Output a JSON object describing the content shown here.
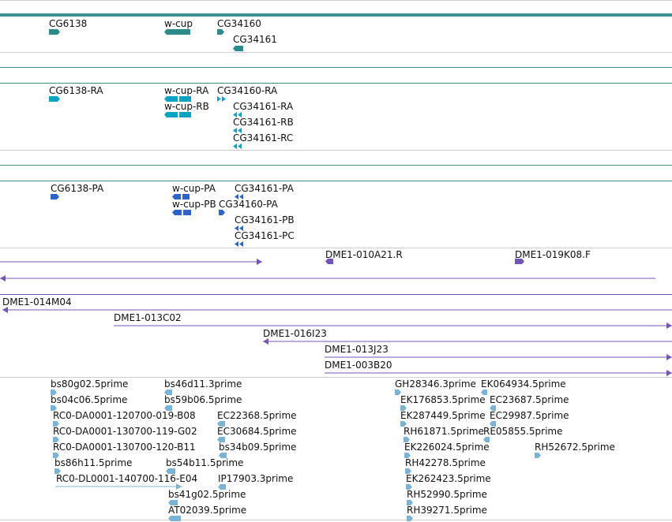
{
  "colors": {
    "gene": "#2b8a8a",
    "mrna": "#0aa3c2",
    "protein": "#2d63c9",
    "clone": "#7355b5",
    "est": "#7ab3d6",
    "divider_gray": "#cfcfcf",
    "divider_teal": "#3f8f8f",
    "divider_purple": "#6b52a8",
    "top_bar": "#3d9090"
  },
  "tracks": {
    "genes": [
      {
        "label": "CG6138",
        "dir": "right"
      },
      {
        "label": "w-cup",
        "dir": "left"
      },
      {
        "label": "CG34160",
        "dir": "right"
      },
      {
        "label": "CG34161",
        "dir": "left"
      }
    ],
    "transcripts": [
      {
        "label": "CG6138-RA",
        "dir": "right"
      },
      {
        "label": "w-cup-RA",
        "dir": "left"
      },
      {
        "label": "w-cup-RB",
        "dir": "left"
      },
      {
        "label": "CG34160-RA",
        "dir": "right"
      },
      {
        "label": "CG34161-RA",
        "dir": "left"
      },
      {
        "label": "CG34161-RB",
        "dir": "left"
      },
      {
        "label": "CG34161-RC",
        "dir": "left"
      }
    ],
    "proteins": [
      {
        "label": "CG6138-PA",
        "dir": "right"
      },
      {
        "label": "w-cup-PA",
        "dir": "left"
      },
      {
        "label": "w-cup-PB",
        "dir": "left"
      },
      {
        "label": "CG34160-PA",
        "dir": "right"
      },
      {
        "label": "CG34161-PA",
        "dir": "left"
      },
      {
        "label": "CG34161-PB",
        "dir": "left"
      },
      {
        "label": "CG34161-PC",
        "dir": "left"
      }
    ],
    "clones": [
      {
        "label": "",
        "dir": "right"
      },
      {
        "label": "DME1-010A21.R",
        "dir": "left"
      },
      {
        "label": "DME1-019K08.F",
        "dir": "right"
      },
      {
        "label": "",
        "dir": "left"
      },
      {
        "label": "DME1-014M04",
        "dir": "left"
      },
      {
        "label": "DME1-013C02",
        "dir": "right"
      },
      {
        "label": "DME1-016I23",
        "dir": "left"
      },
      {
        "label": "DME1-013J23",
        "dir": "right"
      },
      {
        "label": "DME1-003B20",
        "dir": "right"
      }
    ],
    "ests": [
      {
        "label": "bs80g02.5prime",
        "dir": "right"
      },
      {
        "label": "bs04c06.5prime",
        "dir": "right"
      },
      {
        "label": "RC0-DA0001-120700-019-B08",
        "dir": "right"
      },
      {
        "label": "RC0-DA0001-130700-119-G02",
        "dir": "right"
      },
      {
        "label": "RC0-DA0001-130700-120-B11",
        "dir": "right"
      },
      {
        "label": "bs86h11.5prime",
        "dir": "right"
      },
      {
        "label": "RC0-DL0001-140700-116-E04",
        "dir": "right"
      },
      {
        "label": "bs46d11.3prime",
        "dir": "left"
      },
      {
        "label": "bs59b06.5prime",
        "dir": "left"
      },
      {
        "label": "EC22368.5prime",
        "dir": "left"
      },
      {
        "label": "EC30684.5prime",
        "dir": "left"
      },
      {
        "label": "bs34b09.5prime",
        "dir": "left"
      },
      {
        "label": "bs54b11.5prime",
        "dir": "left"
      },
      {
        "label": "IP17903.3prime",
        "dir": "left"
      },
      {
        "label": "bs41g02.5prime",
        "dir": "left"
      },
      {
        "label": "AT02039.5prime",
        "dir": "left"
      },
      {
        "label": "GH28346.3prime",
        "dir": "right"
      },
      {
        "label": "EK176853.5prime",
        "dir": "right"
      },
      {
        "label": "EK287449.5prime",
        "dir": "right"
      },
      {
        "label": "RH61871.5prime",
        "dir": "right"
      },
      {
        "label": "EK226024.5prime",
        "dir": "right"
      },
      {
        "label": "RH42278.5prime",
        "dir": "right"
      },
      {
        "label": "EK262423.5prime",
        "dir": "right"
      },
      {
        "label": "RH52990.5prime",
        "dir": "right"
      },
      {
        "label": "RH39271.5prime",
        "dir": "right"
      },
      {
        "label": "EK064934.5prime",
        "dir": "left"
      },
      {
        "label": "EC23687.5prime",
        "dir": "left"
      },
      {
        "label": "EC29987.5prime",
        "dir": "left"
      },
      {
        "label": "RE05855.5prime",
        "dir": "left"
      },
      {
        "label": "RH52672.5prime",
        "dir": "right"
      }
    ]
  }
}
